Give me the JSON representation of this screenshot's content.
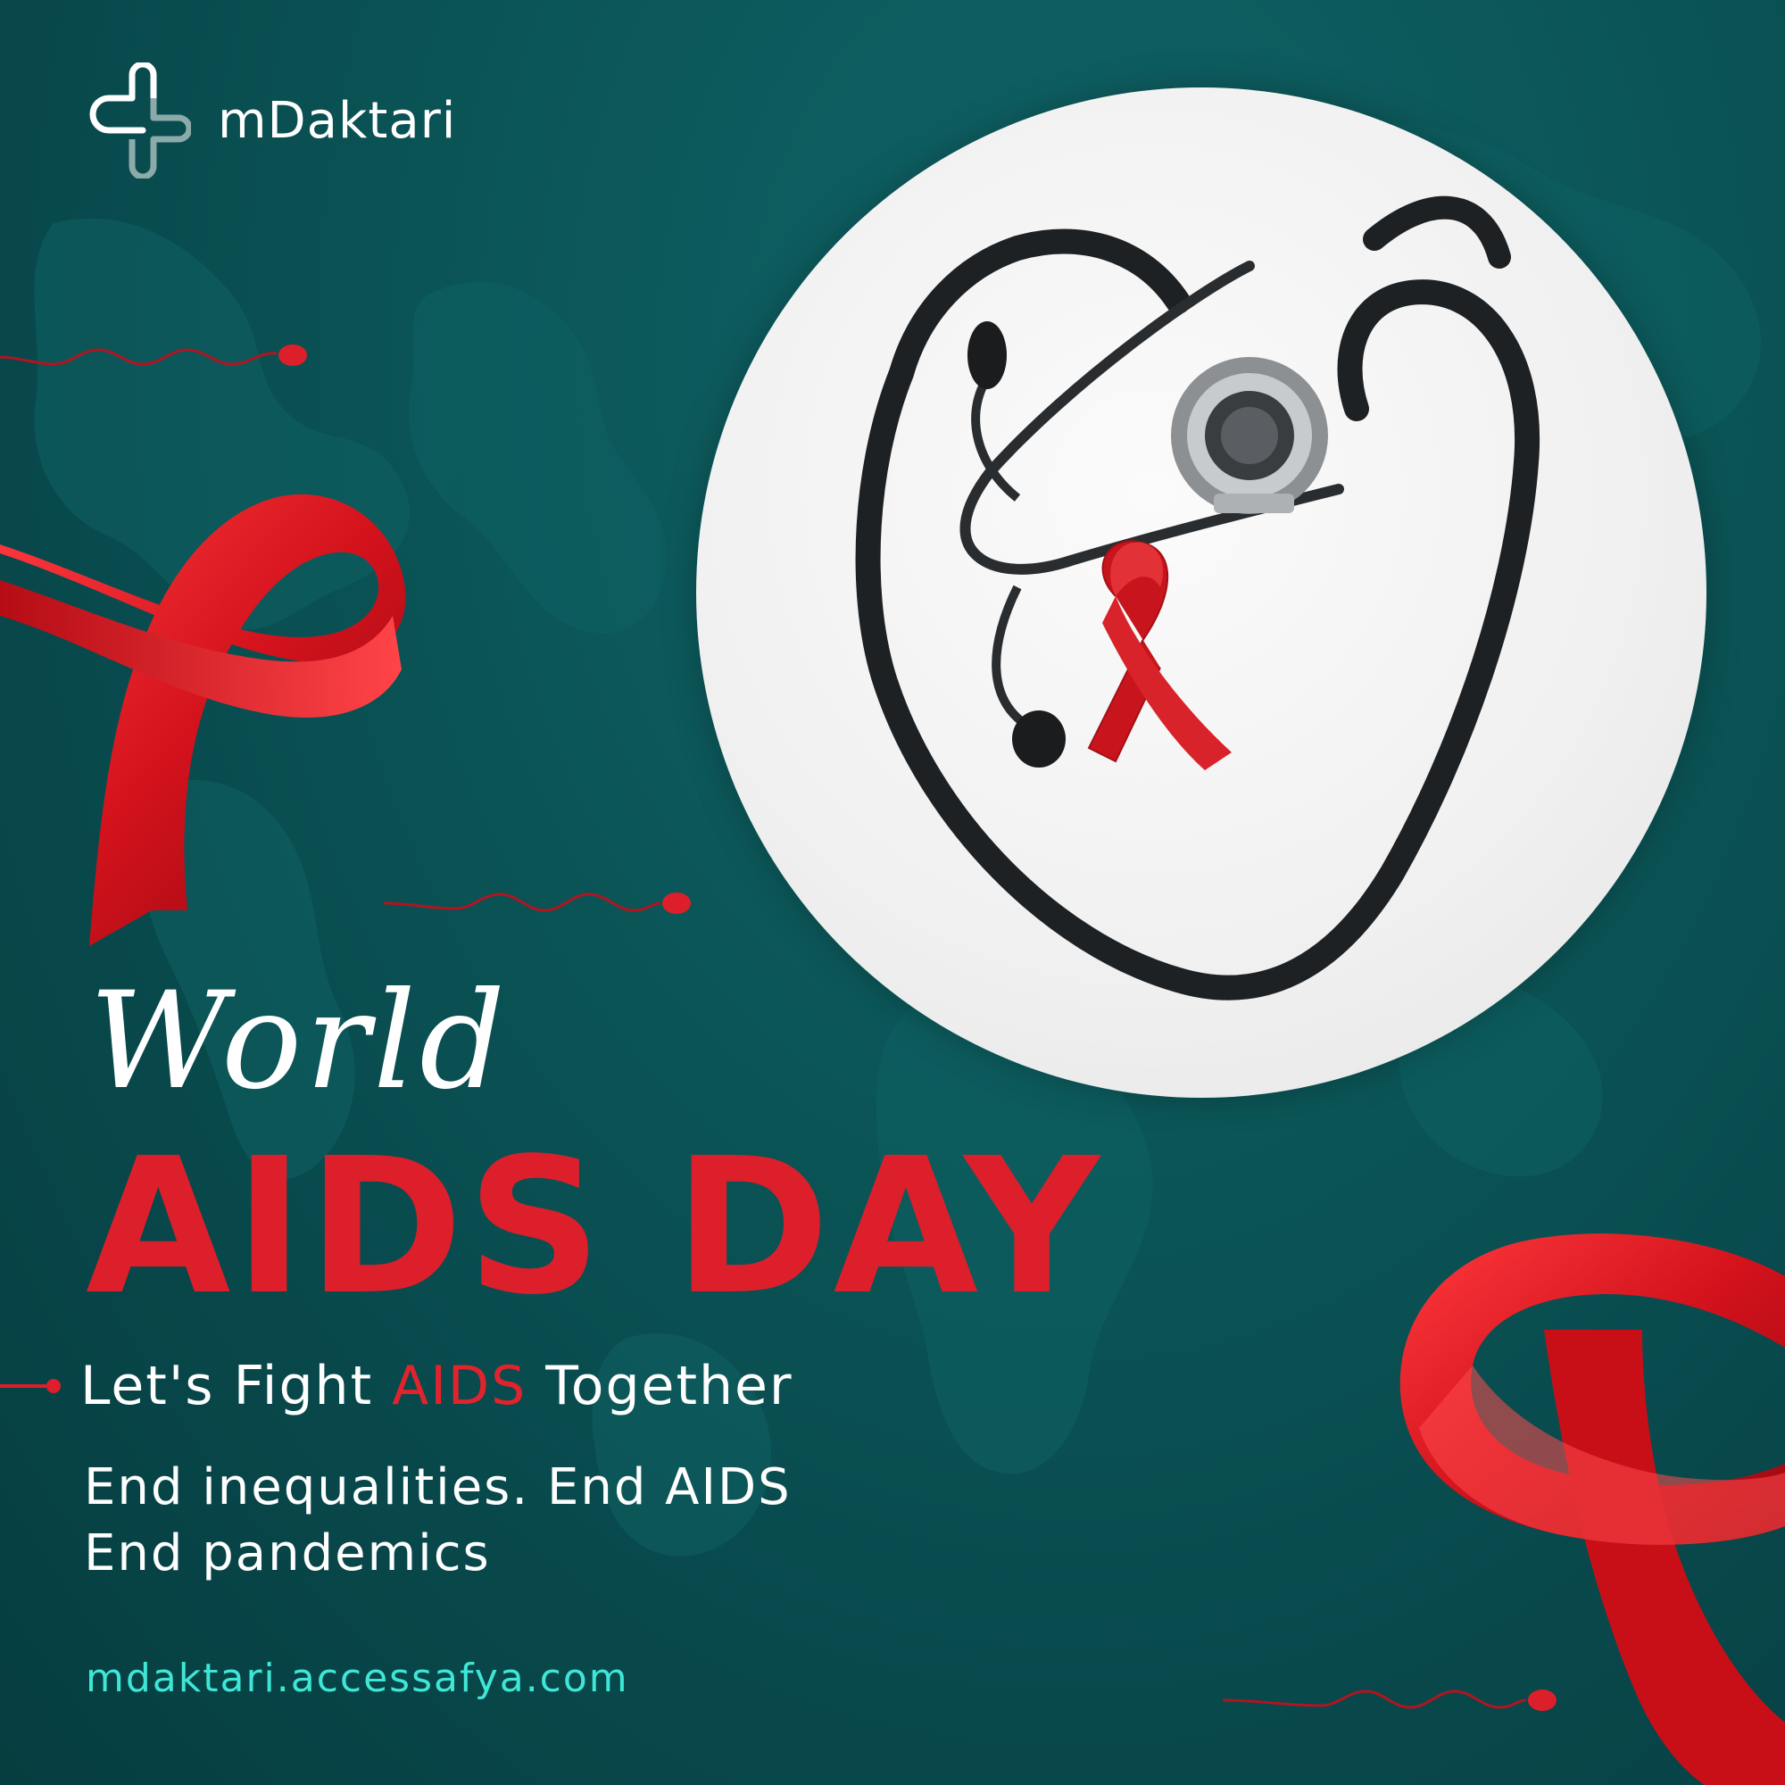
{
  "brand": {
    "name": "mDaktari"
  },
  "headline": {
    "script_word": "World",
    "main": "AIDS DAY"
  },
  "tagline": {
    "before": "Let's Fight ",
    "highlight": "AIDS",
    "after": " Together"
  },
  "slogan": {
    "line1": "End inequalities. End AIDS",
    "line2": "End pandemics"
  },
  "website": "mdaktari.accessafya.com",
  "colors": {
    "background": "#0b5557",
    "accent_red": "#dc1f2b",
    "url_teal": "#3fe6d6",
    "text": "#ffffff"
  },
  "imagery": {
    "photo": "stethoscope-heart-with-red-ribbon",
    "decor": [
      "red-awareness-ribbon",
      "red-awareness-ribbon",
      "world-map",
      "squiggle-lines"
    ]
  }
}
